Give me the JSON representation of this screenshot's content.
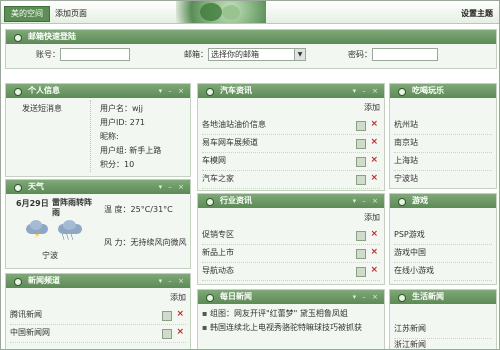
{
  "topbar": {
    "active_tab": "美的空间",
    "add_tab": "添加页面",
    "settings": "设置主题"
  },
  "mail": {
    "title": "邮箱快速登陆",
    "account_label": "账号：",
    "mailbox_label": "邮箱：",
    "mailbox_select": "选择你的邮箱",
    "password_label": "密码："
  },
  "personal": {
    "title": "个人信息",
    "send_message": "发送短消息",
    "username": "用户名：wjj",
    "user_id": "用户ID: 271",
    "nickname": "昵称:",
    "group": "用户组: 新手上路",
    "points": "积分：10"
  },
  "weather": {
    "title": "天气",
    "date": "6月29日",
    "desc": "雷阵雨转阵雨",
    "temp": "温 度：25°C/31°C",
    "city": "宁波",
    "wind": "风 力：无持续风向微风"
  },
  "news_channel": {
    "title": "新闻频道",
    "add": "添加",
    "items": [
      "腾讯新闻",
      "中国新闻网"
    ]
  },
  "car_info": {
    "title": "汽车资讯",
    "add": "添加",
    "items": [
      "各地油站油价信息",
      "易车网车展频道",
      "车模网",
      "汽车之家"
    ]
  },
  "industry_info": {
    "title": "行业资讯",
    "add": "添加",
    "items": [
      "促销专区",
      "新品上市",
      "导航动态"
    ]
  },
  "daily_news": {
    "title": "每日新闻",
    "items": [
      "组图：网友开评\"红蕾梦\" 黛玉相鲁凤姐",
      "韩国连续北上电视秀骆驼特嘛球技巧被抓获"
    ]
  },
  "eat_drink": {
    "title": "吃喝玩乐",
    "items": [
      "杭州站",
      "南京站",
      "上海站",
      "宁波站"
    ]
  },
  "games": {
    "title": "游戏",
    "items": [
      "PSP游戏",
      "游戏中国",
      "在线小游戏"
    ]
  },
  "life_news": {
    "title": "生活新闻",
    "items": [
      "江苏新闻",
      "浙江新闻"
    ]
  },
  "icons": {
    "panel_bullet": "circle-bullet-icon",
    "edit": "edit-icon",
    "delete": "delete-x-icon",
    "weather1": "thunderstorm-cloud-icon",
    "weather2": "rain-cloud-icon"
  },
  "colors": {
    "header_green": "#5c8a55",
    "panel_bg": "#f3f7f1",
    "delete_red": "#cc2222"
  }
}
